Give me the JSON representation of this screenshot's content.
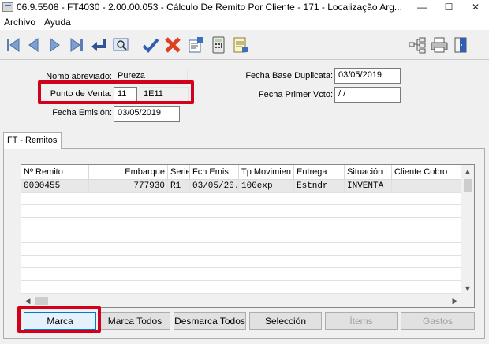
{
  "window": {
    "title": "06.9.5508 - FT4030 - 2.00.00.053 - Cálculo De Remito Por Cliente - 171 - Localização Arg...",
    "minimize": "—",
    "maximize": "☐",
    "close": "✕"
  },
  "menu": {
    "items": [
      "Archivo",
      "Ayuda"
    ]
  },
  "toolbar": {
    "left_icons": [
      "first-icon",
      "previous-icon",
      "next-icon",
      "last-icon",
      "return-icon",
      "view-icon",
      "confirm-icon",
      "cancel-icon",
      "edit-icon",
      "calculator-icon",
      "notes-icon"
    ],
    "right_icons": [
      "tree-icon",
      "print-icon",
      "exit-icon"
    ]
  },
  "form": {
    "nomb_abreviado_label": "Nomb abreviado:",
    "nomb_abreviado_value": "Pureza",
    "punto_venta_label": "Punto de Venta:",
    "punto_venta_value": "11",
    "punto_venta_desc": "1E11",
    "fecha_emision_label": "Fecha Emisión:",
    "fecha_emision_value": "03/05/2019",
    "fecha_base_dup_label": "Fecha Base Duplicata:",
    "fecha_base_dup_value": "03/05/2019",
    "fecha_primer_vcto_label": "Fecha Primer Vcto:",
    "fecha_primer_vcto_value": " / /"
  },
  "tab": {
    "label": "FT - Remitos"
  },
  "grid": {
    "columns": [
      "Nº Remito",
      "Embarque",
      "Serie",
      "Fch Emis",
      "Tp Movimien",
      "Entrega",
      "Situación",
      "Cliente Cobro"
    ],
    "rows": [
      [
        "0000455",
        "777930",
        "R1",
        "03/05/20.",
        "100exp",
        "Estndr",
        "INVENTA",
        ""
      ]
    ]
  },
  "buttons": {
    "marca": "Marca",
    "marca_todos": "Marca Todos",
    "desmarca_todos": "Desmarca Todos",
    "seleccion": "Selección",
    "items": "Ítems",
    "gastos": "Gastos"
  }
}
